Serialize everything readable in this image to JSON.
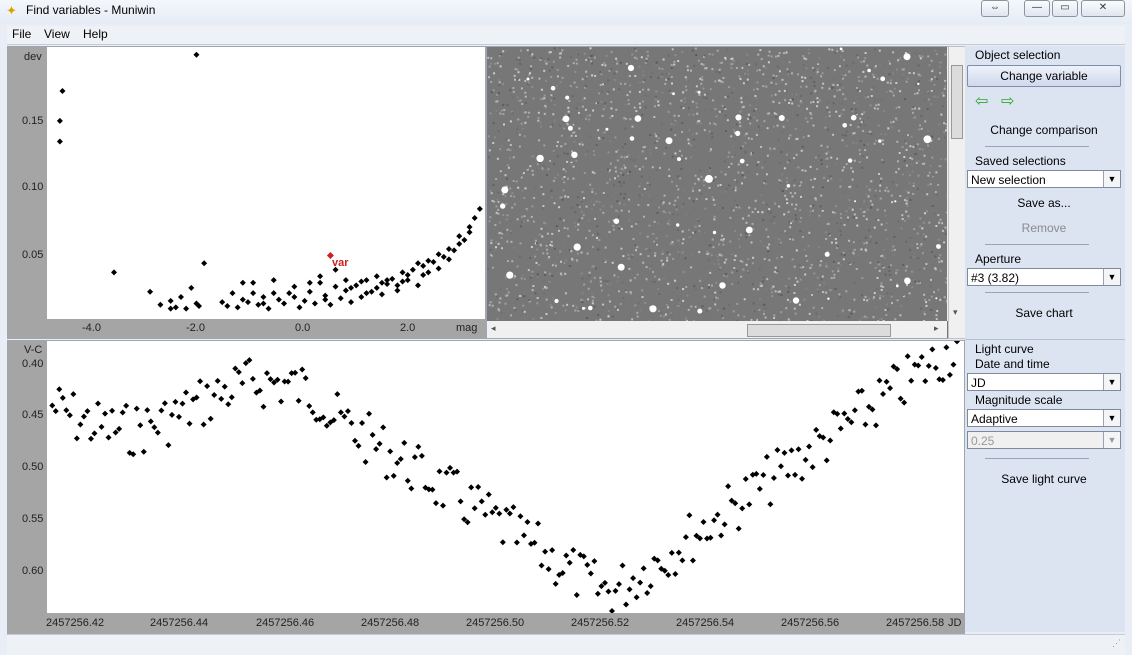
{
  "window": {
    "title": "Find variables - Muniwin"
  },
  "menu": {
    "file": "File",
    "view": "View",
    "help": "Help"
  },
  "top_chart": {
    "chart_data": {
      "type": "scatter",
      "xlabel": "mag",
      "ylabel": "dev",
      "xlim": [
        -5.0,
        3.5
      ],
      "ylim": [
        0.0,
        0.21
      ],
      "x_ticks": [
        "-4.0",
        "-2.0",
        "0.0",
        "2.0"
      ],
      "y_ticks": [
        "0.15",
        "0.10",
        "0.05"
      ],
      "highlight": {
        "label": "var",
        "x": 0.5,
        "y": 0.049,
        "color": "#cc2020"
      },
      "points": [
        [
          -4.75,
          0.137
        ],
        [
          -4.75,
          0.153
        ],
        [
          -4.7,
          0.176
        ],
        [
          -2.1,
          0.204
        ],
        [
          -3.7,
          0.036
        ],
        [
          -3.0,
          0.021
        ],
        [
          -2.8,
          0.011
        ],
        [
          -2.6,
          0.014
        ],
        [
          -2.5,
          0.009
        ],
        [
          -2.4,
          0.017
        ],
        [
          -2.3,
          0.008
        ],
        [
          -2.2,
          0.024
        ],
        [
          -2.1,
          0.012
        ],
        [
          -2.05,
          0.01
        ],
        [
          -1.95,
          0.043
        ],
        [
          -1.5,
          0.01
        ],
        [
          -1.4,
          0.02
        ],
        [
          -1.3,
          0.009
        ],
        [
          -1.2,
          0.015
        ],
        [
          -1.1,
          0.013
        ],
        [
          -1.0,
          0.02
        ],
        [
          -0.9,
          0.011
        ],
        [
          -0.8,
          0.017
        ],
        [
          -0.7,
          0.008
        ],
        [
          -0.6,
          0.03
        ],
        [
          -0.5,
          0.015
        ],
        [
          -0.4,
          0.012
        ],
        [
          -0.3,
          0.02
        ],
        [
          -0.2,
          0.017
        ],
        [
          -0.1,
          0.009
        ],
        [
          0.0,
          0.014
        ],
        [
          0.1,
          0.021
        ],
        [
          0.2,
          0.012
        ],
        [
          0.3,
          0.028
        ],
        [
          0.4,
          0.018
        ],
        [
          0.5,
          0.011
        ],
        [
          0.6,
          0.025
        ],
        [
          0.7,
          0.016
        ],
        [
          0.8,
          0.022
        ],
        [
          0.9,
          0.013
        ],
        [
          1.0,
          0.026
        ],
        [
          1.1,
          0.017
        ],
        [
          1.2,
          0.03
        ],
        [
          1.3,
          0.021
        ],
        [
          1.4,
          0.024
        ],
        [
          1.5,
          0.019
        ],
        [
          1.6,
          0.027
        ],
        [
          1.7,
          0.031
        ],
        [
          1.8,
          0.022
        ],
        [
          1.9,
          0.029
        ],
        [
          2.0,
          0.034
        ],
        [
          2.1,
          0.038
        ],
        [
          2.2,
          0.026
        ],
        [
          2.3,
          0.041
        ],
        [
          2.4,
          0.036
        ],
        [
          2.5,
          0.044
        ],
        [
          2.6,
          0.039
        ],
        [
          2.7,
          0.048
        ],
        [
          2.8,
          0.046
        ],
        [
          2.9,
          0.053
        ],
        [
          3.0,
          0.058
        ],
        [
          3.1,
          0.061
        ],
        [
          3.2,
          0.067
        ],
        [
          3.3,
          0.078
        ],
        [
          3.4,
          0.085
        ],
        [
          -1.0,
          0.028
        ],
        [
          -0.2,
          0.025
        ],
        [
          0.3,
          0.033
        ],
        [
          0.8,
          0.03
        ],
        [
          1.4,
          0.033
        ],
        [
          1.9,
          0.036
        ],
        [
          2.4,
          0.045
        ],
        [
          2.8,
          0.054
        ],
        [
          3.0,
          0.064
        ],
        [
          -1.2,
          0.028
        ],
        [
          0.1,
          0.028
        ],
        [
          0.6,
          0.038
        ],
        [
          1.1,
          0.029
        ],
        [
          1.6,
          0.03
        ],
        [
          2.2,
          0.043
        ],
        [
          -0.6,
          0.02
        ],
        [
          0.9,
          0.024
        ],
        [
          1.5,
          0.028
        ],
        [
          2.0,
          0.03
        ],
        [
          2.6,
          0.05
        ],
        [
          3.2,
          0.071
        ],
        [
          -2.6,
          0.008
        ],
        [
          -1.6,
          0.013
        ],
        [
          -0.8,
          0.012
        ],
        [
          0.4,
          0.015
        ],
        [
          1.2,
          0.02
        ],
        [
          1.8,
          0.026
        ],
        [
          2.3,
          0.034
        ]
      ]
    }
  },
  "bottom_chart": {
    "chart_data": {
      "type": "scatter",
      "xlabel": "JD",
      "ylabel": "V-C",
      "xlim": [
        2457256.41,
        2457256.585
      ],
      "ylim": [
        0.4,
        0.63
      ],
      "x_ticks": [
        "2457256.42",
        "2457256.44",
        "2457256.46",
        "2457256.48",
        "2457256.50",
        "2457256.52",
        "2457256.54",
        "2457256.56",
        "2457256.58"
      ],
      "y_ticks": [
        "0.40",
        "0.45",
        "0.50",
        "0.55",
        "0.60"
      ],
      "series": [
        {
          "x_start": 2457256.411,
          "x_end": 2457256.585,
          "count": 260
        }
      ]
    }
  },
  "sidebar": {
    "object_selection": "Object selection",
    "change_variable": "Change variable",
    "change_comparison": "Change comparison",
    "saved_selections": "Saved selections",
    "saved_value": "New selection",
    "save_as": "Save as...",
    "remove": "Remove",
    "aperture": "Aperture",
    "aperture_value": "#3 (3.82)",
    "save_chart": "Save chart",
    "light_curve": "Light curve",
    "date_and_time": "Date and time",
    "date_value": "JD",
    "magnitude_scale": "Magnitude scale",
    "scale_value": "Adaptive",
    "scale_amount": "0.25",
    "save_light_curve": "Save light curve"
  },
  "colors": {
    "accent": "#2ea82e",
    "highlight": "#cc2020",
    "panel": "#dce4f2"
  }
}
